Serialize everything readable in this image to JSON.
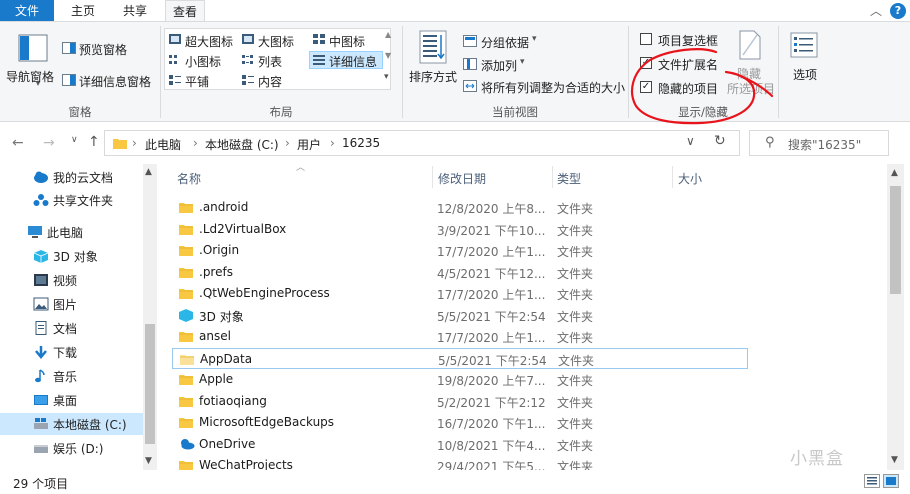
{
  "ribbon_tabs": [
    "文件",
    "主页",
    "共享",
    "查看"
  ],
  "ribbon": {
    "panes": {
      "label": "窗格",
      "nav_pane": "导航窗格",
      "preview_pane": "预览窗格",
      "details_pane": "详细信息窗格"
    },
    "layout": {
      "label": "布局",
      "options": [
        "超大图标",
        "大图标",
        "中图标",
        "小图标",
        "列表",
        "详细信息",
        "平铺",
        "内容"
      ],
      "selected": "详细信息"
    },
    "current_view": {
      "label": "当前视图",
      "sort_by": "排序方式",
      "group_by": "分组依据",
      "add_columns": "添加列",
      "fit_columns": "将所有列调整为合适的大小"
    },
    "show_hide": {
      "label": "显示/隐藏",
      "item_checkboxes": "项目复选框",
      "file_extensions": "文件扩展名",
      "hidden_items": "隐藏的项目",
      "hide_selected_1": "隐藏",
      "hide_selected_2": "所选项目"
    },
    "options": "选项"
  },
  "address": {
    "crumbs": [
      "此电脑",
      "本地磁盘 (C:)",
      "用户",
      "16235"
    ],
    "search_placeholder": "搜索\"16235\""
  },
  "nav_pane": [
    {
      "label": "我的云文档",
      "icon": "cloud-doc-icon"
    },
    {
      "label": "共享文件夹",
      "icon": "shared-folder-icon"
    },
    {
      "label": "此电脑",
      "icon": "pc-icon"
    },
    {
      "label": "3D 对象",
      "icon": "3d-objects-icon"
    },
    {
      "label": "视频",
      "icon": "video-icon"
    },
    {
      "label": "图片",
      "icon": "pictures-icon"
    },
    {
      "label": "文档",
      "icon": "documents-icon"
    },
    {
      "label": "下载",
      "icon": "download-icon"
    },
    {
      "label": "音乐",
      "icon": "music-icon"
    },
    {
      "label": "桌面",
      "icon": "desktop-icon"
    },
    {
      "label": "本地磁盘 (C:)",
      "icon": "drive-c-icon"
    },
    {
      "label": "娱乐 (D:)",
      "icon": "drive-d-icon"
    }
  ],
  "columns": [
    "名称",
    "修改日期",
    "类型",
    "大小"
  ],
  "files": [
    {
      "name": ".android",
      "date": "12/8/2020 上午8...",
      "type": "文件夹",
      "icon": "folder"
    },
    {
      "name": ".Ld2VirtualBox",
      "date": "3/9/2021 下午10...",
      "type": "文件夹",
      "icon": "folder"
    },
    {
      "name": ".Origin",
      "date": "17/7/2020 上午1...",
      "type": "文件夹",
      "icon": "folder"
    },
    {
      "name": ".prefs",
      "date": "4/5/2021 下午12...",
      "type": "文件夹",
      "icon": "folder"
    },
    {
      "name": ".QtWebEngineProcess",
      "date": "17/7/2020 上午1...",
      "type": "文件夹",
      "icon": "folder"
    },
    {
      "name": "3D 对象",
      "date": "5/5/2021 下午2:54",
      "type": "文件夹",
      "icon": "3d"
    },
    {
      "name": "ansel",
      "date": "17/7/2020 上午1...",
      "type": "文件夹",
      "icon": "folder"
    },
    {
      "name": "AppData",
      "date": "5/5/2021 下午2:54",
      "type": "文件夹",
      "icon": "folder-light"
    },
    {
      "name": "Apple",
      "date": "19/8/2020 上午7...",
      "type": "文件夹",
      "icon": "folder"
    },
    {
      "name": "fotiaoqiang",
      "date": "5/2/2021 下午2:12",
      "type": "文件夹",
      "icon": "folder"
    },
    {
      "name": "MicrosoftEdgeBackups",
      "date": "16/7/2020 下午1...",
      "type": "文件夹",
      "icon": "folder"
    },
    {
      "name": "OneDrive",
      "date": "10/8/2021 下午4...",
      "type": "文件夹",
      "icon": "onedrive"
    },
    {
      "name": "WeChatProjects",
      "date": "29/4/2021 下午5...",
      "type": "文件夹",
      "icon": "folder"
    }
  ],
  "status": "29 个项目",
  "watermark": "小黑盒",
  "colors": {
    "accent": "#1979ca",
    "folder": "#f8c843",
    "annotation": "#e8141c"
  }
}
